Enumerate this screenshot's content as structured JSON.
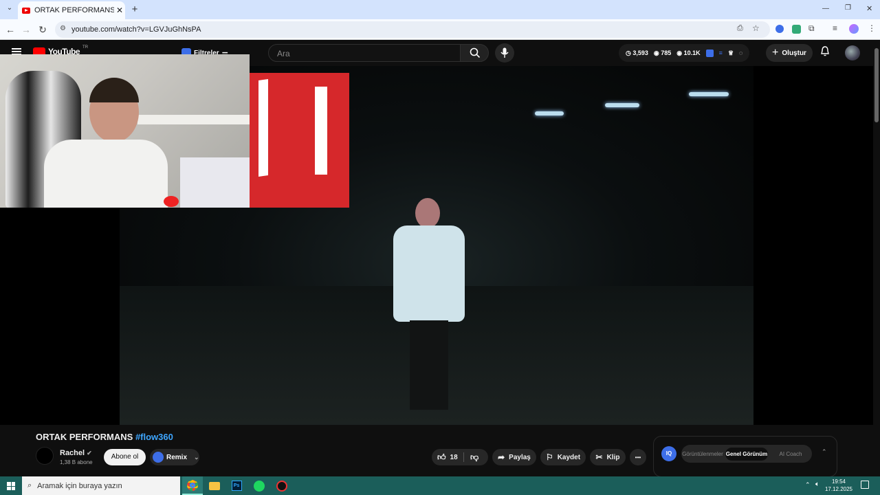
{
  "browser": {
    "tab_title": "ORTAK PERFORMANS #flow360",
    "tab_close": "✕",
    "new_tab": "+",
    "url": "youtube.com/watch?v=LGVJuGhNsPA",
    "window_controls": {
      "minimize": "—",
      "restore": "❐",
      "close": "✕"
    }
  },
  "youtube": {
    "logo_text": "YouTube",
    "region": "TR",
    "filters_label": "Filtreler",
    "search_placeholder": "Ara",
    "stats": {
      "likes": "3,593",
      "views_a": "785",
      "views_b": "10.1K"
    },
    "create_label": "Oluştur"
  },
  "video": {
    "title_main": "ORTAK PERFORMANS",
    "title_tag": "#flow360",
    "channel_name": "Rachel",
    "subscribers": "1,38 B abone",
    "subscribe_label": "Abone ol",
    "remix_label": "Remix",
    "like_count": "18",
    "share_label": "Paylaş",
    "save_label": "Kaydet",
    "clip_label": "Klip",
    "more_label": "•••"
  },
  "iq_panel": {
    "badge": "IQ",
    "tabs": [
      "Görüntülenmeler",
      "Genel Görünüm",
      "AI Coach"
    ],
    "active_tab": "Genel Görünüm"
  },
  "taskbar": {
    "search_placeholder": "Aramak için buraya yazın",
    "time": "19:54",
    "date": "17.12.2025"
  },
  "colors": {
    "youtube_red": "#ff0000",
    "link_blue": "#3ea6ff",
    "taskbar": "#1b5e5a",
    "iq_blue": "#3d6ee8"
  }
}
